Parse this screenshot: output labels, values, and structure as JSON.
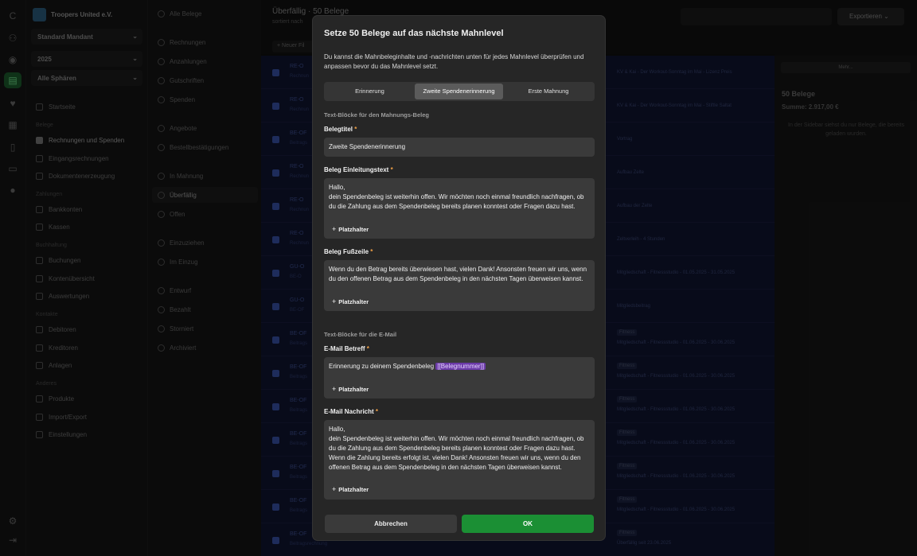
{
  "app": {
    "org_name": "Troopers United e.V."
  },
  "sidebar": {
    "mandant": "Standard Mandant",
    "year": "2025",
    "sphere": "Alle Sphären",
    "items": [
      {
        "label": "Startseite",
        "section": ""
      },
      {
        "label": "Rechnungen und Spenden",
        "section": "Belege"
      },
      {
        "label": "Eingangsrechnungen",
        "section": ""
      },
      {
        "label": "Dokumentenerzeugung",
        "section": ""
      },
      {
        "label": "Bankkonten",
        "section": "Zahlungen"
      },
      {
        "label": "Kassen",
        "section": ""
      },
      {
        "label": "Buchungen",
        "section": "Buchhaltung"
      },
      {
        "label": "Kontenübersicht",
        "section": ""
      },
      {
        "label": "Auswertungen",
        "section": ""
      },
      {
        "label": "Debitoren",
        "section": "Kontakte"
      },
      {
        "label": "Kreditoren",
        "section": ""
      },
      {
        "label": "Anlagen",
        "section": ""
      },
      {
        "label": "Produkte",
        "section": "Anderes"
      },
      {
        "label": "Import/Export",
        "section": ""
      },
      {
        "label": "Einstellungen",
        "section": ""
      }
    ],
    "sections": [
      "Belege",
      "Zahlungen",
      "Buchhaltung",
      "Kontakte",
      "Anderes"
    ]
  },
  "filters": {
    "items": [
      "Alle Belege",
      "Rechnungen",
      "Anzahlungen",
      "Gutschriften",
      "Spenden",
      "Angebote",
      "Bestellbestätigungen",
      "In Mahnung",
      "Überfällig",
      "Offen",
      "Einzuziehen",
      "Im Einzug",
      "Entwurf",
      "Bezahlt",
      "Storniert",
      "Archiviert"
    ]
  },
  "main": {
    "title": "Überfällig",
    "title_suffix": "· 50 Belege",
    "subtitle": "sortiert nach",
    "new_button": "+ Neuer Fil",
    "rows": [
      {
        "name": "RE-O",
        "sub": "Rechnun",
        "tag": "",
        "desc": "KV & Kai - Der Workout-Sonntag im Mai - Lizenz Preis"
      },
      {
        "name": "RE-O",
        "sub": "Rechnun",
        "tag": "",
        "desc": "KV & Kai - Der Workout-Sonntag im Mai - Stiftle Saltat"
      },
      {
        "name": "BE-OF",
        "sub": "Beitrags",
        "tag": "",
        "desc": "Vortrag"
      },
      {
        "name": "RE-O",
        "sub": "Rechnun",
        "tag": "",
        "desc": "Aufbau Zelte"
      },
      {
        "name": "RE-O",
        "sub": "Rechnun",
        "tag": "",
        "desc": "Aufbau der Zelte"
      },
      {
        "name": "RE-O",
        "sub": "Rechnun",
        "tag": "",
        "desc": "Zeltverleih - 4 Stunden"
      },
      {
        "name": "GU-O",
        "sub": "BE-O",
        "tag": "",
        "desc": "Mitgliedschaft - Fitnessstudio - 01.05.2025 - 31.05.2025"
      },
      {
        "name": "GU-O",
        "sub": "BE-OF",
        "tag": "",
        "desc": "Mitgliedsbeitrag"
      },
      {
        "name": "BE-OF",
        "sub": "Beitrags",
        "tag": "Fitness",
        "desc": "Mitgliedschaft - Fitnessstudio - 01.06.2025 - 30.06.2025"
      },
      {
        "name": "BE-OF",
        "sub": "Beitrags",
        "tag": "Fitness",
        "desc": "Mitgliedschaft - Fitnessstudio - 01.06.2025 - 30.06.2025"
      },
      {
        "name": "BE-OF",
        "sub": "Beitrags",
        "tag": "Fitness",
        "desc": "Mitgliedschaft - Fitnessstudio - 01.06.2025 - 30.06.2025"
      },
      {
        "name": "BE-OF",
        "sub": "Beitrags",
        "tag": "Fitness",
        "desc": "Mitgliedschaft - Fitnessstudio - 01.06.2025 - 30.06.2025"
      },
      {
        "name": "BE-OF",
        "sub": "Beitrags",
        "tag": "Fitness",
        "desc": "Mitgliedschaft - Fitnessstudio - 01.06.2025 - 30.06.2025"
      },
      {
        "name": "BE-OF",
        "sub": "Beitrags",
        "tag": "Fitness",
        "desc": "Mitgliedschaft - Fitnessstudio - 01.06.2025 - 30.06.2025"
      },
      {
        "name": "BE-OF",
        "sub": "Beitragsrechnung",
        "tag": "Fitness",
        "desc": "Überfällig seit 23.06.2025"
      }
    ]
  },
  "right": {
    "export_label": "Exportieren",
    "mehr_label": "Mehr...",
    "count": "50 Belege",
    "sum": "Summe: 2.917,00 €",
    "hint": "In der Sidebar siehst du nur Belege, die bereits geladen wurden."
  },
  "modal": {
    "title": "Setze 50 Belege auf das nächste Mahnlevel",
    "description": "Du kannst die Mahnbeleginhalte und -nachrichten unten für jedes Mahnlevel überprüfen und anpassen bevor du das Mahnlevel setzt.",
    "tabs": [
      {
        "label": "Erinnerung",
        "active": false
      },
      {
        "label": "Zweite Spendenerinnerung",
        "active": true
      },
      {
        "label": "Erste Mahnung",
        "active": false
      }
    ],
    "section_doc": "Text-Blöcke für den Mahnungs-Beleg",
    "section_mail": "Text-Blöcke für die E-Mail",
    "required_mark": "*",
    "placeholder_label": "Platzhalter",
    "fields": {
      "belegtitel": {
        "label": "Belegtitel",
        "value": "Zweite Spendenerinnerung"
      },
      "einleitung": {
        "label": "Beleg Einleitungstext",
        "value": "Hallo,\ndein Spendenbeleg ist weiterhin offen. Wir möchten noch einmal freundlich nachfragen, ob du die Zahlung aus dem Spendenbeleg bereits planen konntest oder Fragen dazu hast."
      },
      "fusszeile": {
        "label": "Beleg Fußzeile",
        "value": "Wenn du den Betrag bereits überwiesen hast, vielen Dank! Ansonsten freuen wir uns, wenn du den offenen Betrag aus dem Spendenbeleg in den nächsten Tagen überweisen kannst."
      },
      "betreff": {
        "label": "E-Mail Betreff",
        "value": "Erinnerung zu deinem Spendenbeleg",
        "token": "[[Belegnummer]]"
      },
      "nachricht": {
        "label": "E-Mail Nachricht",
        "value": "Hallo,\ndein Spendenbeleg ist weiterhin offen. Wir möchten noch einmal freundlich nachfragen, ob du die Zahlung aus dem Spendenbeleg bereits planen konntest oder Fragen dazu hast.\nWenn die Zahlung bereits erfolgt ist, vielen Dank! Ansonsten freuen wir uns, wenn du den offenen Betrag aus dem Spendenbeleg in den nächsten Tagen überweisen kannst."
      }
    },
    "cancel_label": "Abbrechen",
    "ok_label": "OK"
  },
  "colors": {
    "accent_green": "#1b8f34",
    "token_purple": "#6b3aa8",
    "required_orange": "#f0a046"
  }
}
